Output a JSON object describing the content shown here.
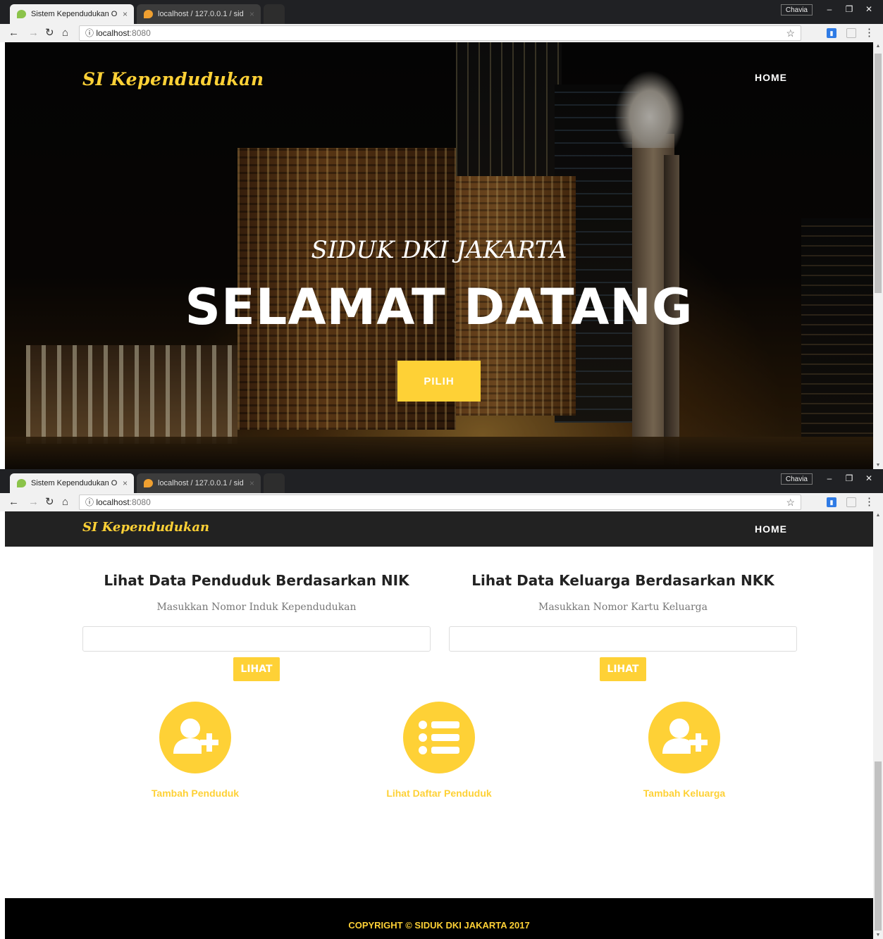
{
  "browser": {
    "tabs": [
      {
        "title": "Sistem Kependudukan O"
      },
      {
        "title": "localhost / 127.0.0.1 / sid"
      }
    ],
    "user": "Chavia",
    "url_host": "localhost",
    "url_port": ":8080"
  },
  "hero": {
    "brand": "SI Kependudukan",
    "nav_home": "HOME",
    "subheading": "SIDUK DKI JAKARTA",
    "heading": "SELAMAT DATANG",
    "button": "PILIH"
  },
  "page": {
    "brand": "SI Kependudukan",
    "nav_home": "HOME",
    "nik": {
      "title": "Lihat Data Penduduk Berdasarkan NIK",
      "hint": "Masukkan Nomor Induk Kependudukan",
      "value": "",
      "button": "LIHAT"
    },
    "nkk": {
      "title": "Lihat Data Keluarga Berdasarkan NKK",
      "hint": "Masukkan Nomor Kartu Keluarga",
      "value": "",
      "button": "LIHAT"
    },
    "features": [
      {
        "label": "Tambah Penduduk",
        "icon": "user-plus-icon"
      },
      {
        "label": "Lihat Daftar Penduduk",
        "icon": "list-icon"
      },
      {
        "label": "Tambah Keluarga",
        "icon": "user-plus-icon"
      }
    ],
    "footer": "COPYRIGHT © SIDUK DKI JAKARTA 2017"
  },
  "colors": {
    "accent": "#fed136",
    "navbar": "#222222",
    "footer": "#000000"
  }
}
